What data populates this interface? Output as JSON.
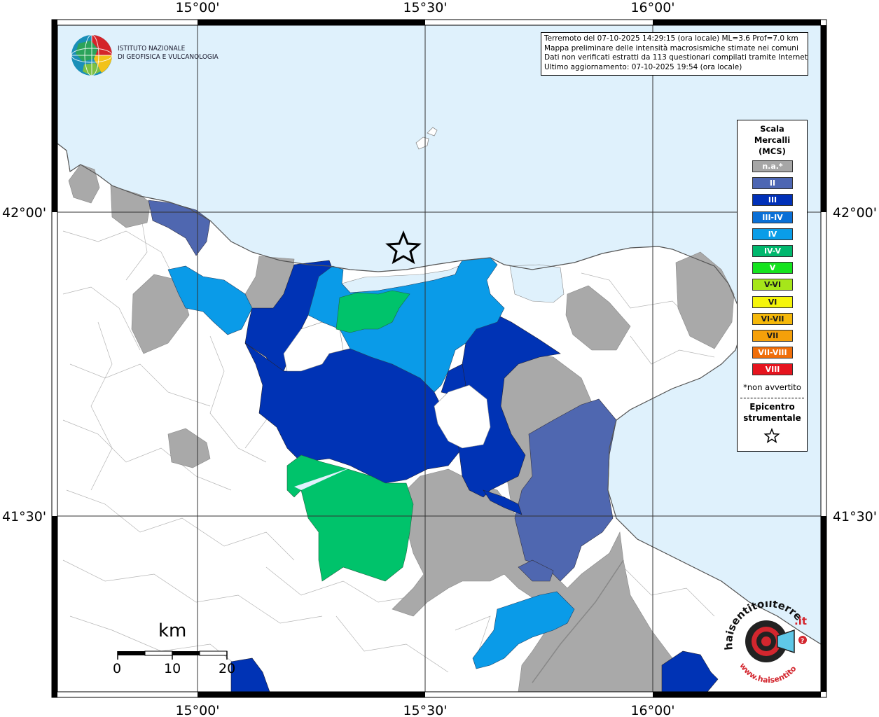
{
  "map": {
    "axes": {
      "top_lon_labels": [
        "15°00'",
        "15°30'",
        "16°00'"
      ],
      "bottom_lon_labels": [
        "15°00'",
        "15°30'",
        "16°00'"
      ],
      "left_lat_labels": [
        "42°00'",
        "41°30'"
      ],
      "right_lat_labels": [
        "42°00'",
        "41°30'"
      ]
    },
    "colors": {
      "sea": "#dff1fc",
      "land": "#ffffff",
      "border": "#aaaaaa",
      "na": "#a9a9a9",
      "II": "#4f67b0",
      "III": "#0033b5",
      "IV": "#0a9be8",
      "V": "#00c36b"
    }
  },
  "institute": {
    "line1": "ISTITUTO NAZIONALE",
    "line2": "DI GEOFISICA E VULCANOLOGIA"
  },
  "info": {
    "line1": "Terremoto del 07-10-2025 14:29:15 (ora locale) ML=3.6 Prof=7.0 km",
    "line2": "Mappa preliminare delle intensità macrosismiche stimate nei comuni",
    "line3": "Dati non verificati estratti da 113 questionari compilati tramite Internet.",
    "line4": "Ultimo aggiornamento: 07-10-2025 19:54 (ora locale)"
  },
  "legend": {
    "title_line1": "Scala",
    "title_line2": "Mercalli",
    "title_line3": "(MCS)",
    "items": [
      {
        "label": "n.a.*",
        "color": "#a6a6a6"
      },
      {
        "label": "II",
        "color": "#4d66b3"
      },
      {
        "label": "III",
        "color": "#0030b8"
      },
      {
        "label": "III-IV",
        "color": "#0a6fd6"
      },
      {
        "label": "IV",
        "color": "#0a9de8"
      },
      {
        "label": "IV-V",
        "color": "#00b86e"
      },
      {
        "label": "V",
        "color": "#14e41e"
      },
      {
        "label": "V-VI",
        "color": "#a6e61a"
      },
      {
        "label": "VI",
        "color": "#f5f50a"
      },
      {
        "label": "VI-VII",
        "color": "#f5b80a"
      },
      {
        "label": "VII",
        "color": "#f5a00a"
      },
      {
        "label": "VII-VIII",
        "color": "#f06e0a"
      },
      {
        "label": "VIII",
        "color": "#e6141e"
      }
    ],
    "na_note": "*non avvertito",
    "epicenter_line1": "Epicentro",
    "epicenter_line2": "strumentale"
  },
  "scale_bar": {
    "unit": "km",
    "ticks": [
      "0",
      "10",
      "20"
    ]
  },
  "hai_sentito": {
    "text_top": "haisentitoilterremoto",
    "text_it": ".it",
    "text_bottom": "www.haisentito"
  }
}
